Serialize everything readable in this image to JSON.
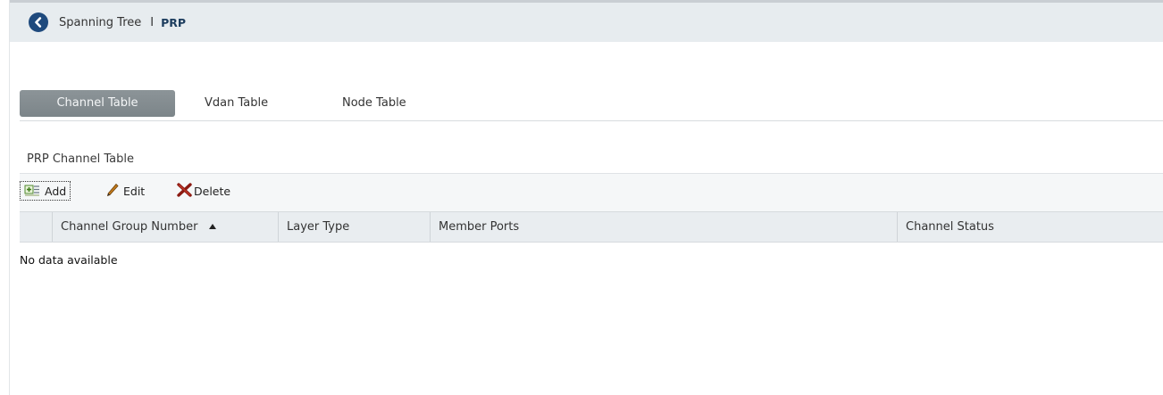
{
  "breadcrumb": {
    "parent": "Spanning Tree",
    "separator": "I",
    "current": "PRP"
  },
  "tabs": [
    {
      "label": "Channel Table",
      "active": true
    },
    {
      "label": "Vdan Table",
      "active": false
    },
    {
      "label": "Node Table",
      "active": false
    }
  ],
  "section": {
    "title": "PRP Channel Table"
  },
  "toolbar": {
    "add_label": "Add",
    "edit_label": "Edit",
    "delete_label": "Delete"
  },
  "table": {
    "columns": [
      {
        "label": "Channel Group Number",
        "sorted": "ascending"
      },
      {
        "label": "Layer Type"
      },
      {
        "label": "Member Ports"
      },
      {
        "label": "Channel Status"
      }
    ],
    "rows": [],
    "empty_message": "No data available"
  },
  "colors": {
    "header_bg": "#e7ecef",
    "back_icon": "#1f4a7d",
    "active_tab": "#858d91",
    "delete_x": "#8b1a12"
  }
}
